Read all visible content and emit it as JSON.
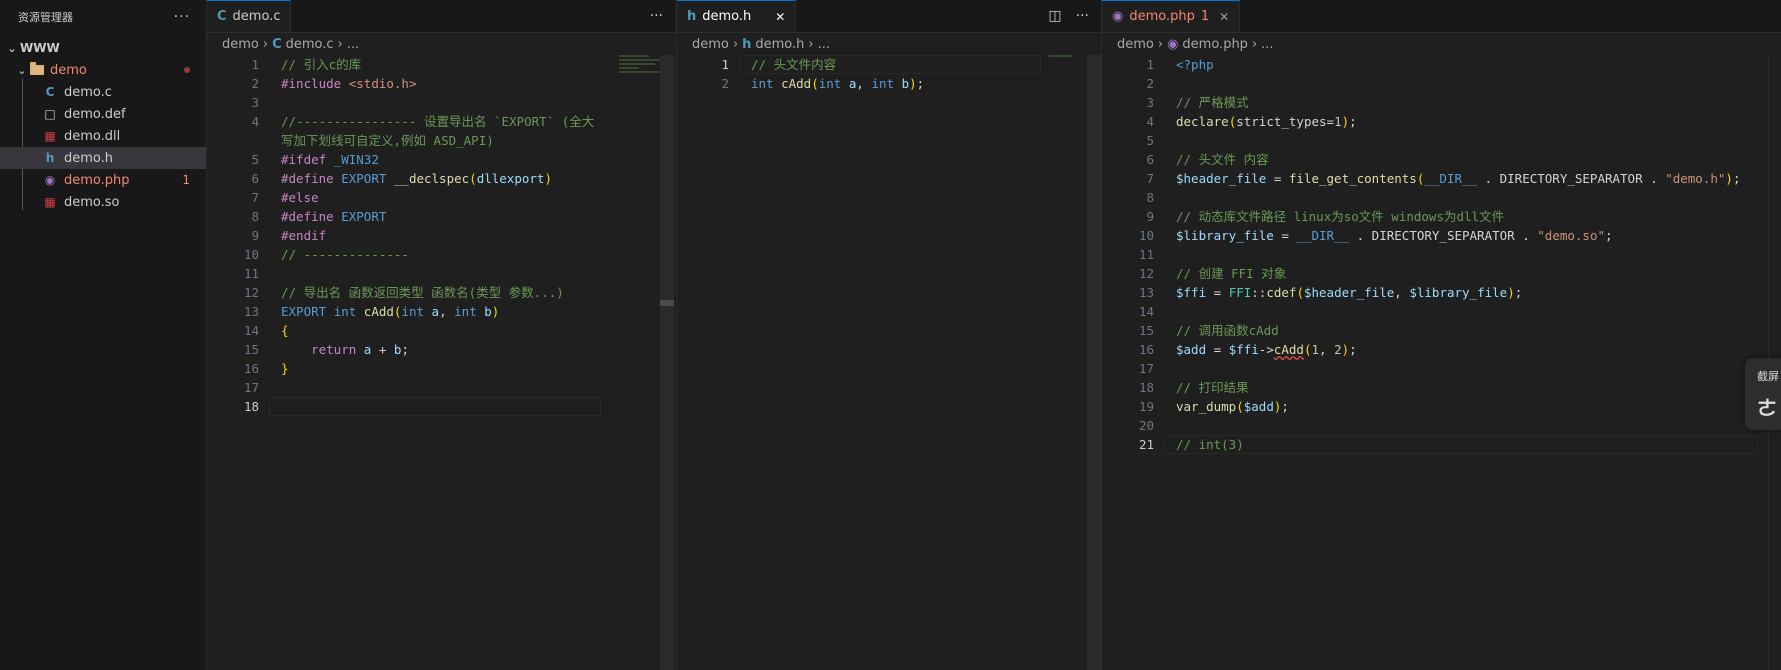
{
  "explorer": {
    "title": "资源管理器",
    "more": "···",
    "root": "WWW",
    "folder": "demo",
    "files": [
      {
        "name": "demo.c",
        "icon": "C",
        "color": "#519aba"
      },
      {
        "name": "demo.def",
        "icon": "□",
        "color": "#cccccc"
      },
      {
        "name": "demo.dll",
        "icon": "▦",
        "color": "#cc3e44"
      },
      {
        "name": "demo.h",
        "icon": "h",
        "color": "#519aba"
      },
      {
        "name": "demo.php",
        "icon": "◉",
        "color": "#a074c4",
        "badge": "1"
      },
      {
        "name": "demo.so",
        "icon": "▦",
        "color": "#cc3e44"
      }
    ]
  },
  "group1": {
    "tab": "demo.c",
    "tab_icon": "C",
    "more": "···",
    "breadcrumb": {
      "folder": "demo",
      "file": "demo.c",
      "rest": "..."
    },
    "current_line": 18,
    "lines": [
      {
        "n": 1,
        "segs": [
          [
            "c-com",
            "// 引入c的库"
          ]
        ]
      },
      {
        "n": 2,
        "segs": [
          [
            "c-pre",
            "#include"
          ],
          [
            "c-plain",
            " "
          ],
          [
            "c-str",
            "<stdio.h>"
          ]
        ]
      },
      {
        "n": 3,
        "segs": []
      },
      {
        "n": 4,
        "segs": [
          [
            "c-com",
            "//---------------- 设置导出名 `EXPORT` (全大"
          ]
        ]
      },
      {
        "n": "",
        "segs": [
          [
            "c-com",
            "写加下划线可自定义,例如 ASD_API)"
          ]
        ]
      },
      {
        "n": 5,
        "segs": [
          [
            "c-pre",
            "#ifdef"
          ],
          [
            "c-plain",
            " "
          ],
          [
            "c-kw",
            "_WIN32"
          ]
        ]
      },
      {
        "n": 6,
        "segs": [
          [
            "c-pre",
            "#define"
          ],
          [
            "c-plain",
            " "
          ],
          [
            "c-macro",
            "EXPORT"
          ],
          [
            "c-plain",
            " "
          ],
          [
            "c-fn",
            "__declspec"
          ],
          [
            "c-br",
            "("
          ],
          [
            "c-var",
            "dllexport"
          ],
          [
            "c-br",
            ")"
          ]
        ]
      },
      {
        "n": 7,
        "segs": [
          [
            "c-pre",
            "#else"
          ]
        ]
      },
      {
        "n": 8,
        "segs": [
          [
            "c-pre",
            "#define"
          ],
          [
            "c-plain",
            " "
          ],
          [
            "c-macro",
            "EXPORT"
          ]
        ]
      },
      {
        "n": 9,
        "segs": [
          [
            "c-pre",
            "#endif"
          ]
        ]
      },
      {
        "n": 10,
        "segs": [
          [
            "c-com",
            "// --------------"
          ]
        ]
      },
      {
        "n": 11,
        "segs": []
      },
      {
        "n": 12,
        "segs": [
          [
            "c-com",
            "// 导出名 函数返回类型 函数名(类型 参数...)"
          ]
        ]
      },
      {
        "n": 13,
        "segs": [
          [
            "c-macro",
            "EXPORT"
          ],
          [
            "c-plain",
            " "
          ],
          [
            "c-kw",
            "int"
          ],
          [
            "c-plain",
            " "
          ],
          [
            "c-fn",
            "cAdd"
          ],
          [
            "c-br",
            "("
          ],
          [
            "c-kw",
            "int"
          ],
          [
            "c-plain",
            " "
          ],
          [
            "c-var",
            "a"
          ],
          [
            "c-plain",
            ", "
          ],
          [
            "c-kw",
            "int"
          ],
          [
            "c-plain",
            " "
          ],
          [
            "c-var",
            "b"
          ],
          [
            "c-br",
            ")"
          ]
        ]
      },
      {
        "n": 14,
        "segs": [
          [
            "c-br",
            "{"
          ]
        ]
      },
      {
        "n": 15,
        "segs": [
          [
            "c-plain",
            "    "
          ],
          [
            "c-pre",
            "return"
          ],
          [
            "c-plain",
            " "
          ],
          [
            "c-var",
            "a"
          ],
          [
            "c-plain",
            " + "
          ],
          [
            "c-var",
            "b"
          ],
          [
            "c-plain",
            ";"
          ]
        ]
      },
      {
        "n": 16,
        "segs": [
          [
            "c-br",
            "}"
          ]
        ]
      },
      {
        "n": 17,
        "segs": []
      },
      {
        "n": 18,
        "segs": []
      }
    ]
  },
  "group2": {
    "tab": "demo.h",
    "tab_icon": "h",
    "close": "✕",
    "more": "···",
    "split": "◫",
    "breadcrumb": {
      "folder": "demo",
      "file": "demo.h",
      "rest": "..."
    },
    "current_line": 1,
    "lines": [
      {
        "n": 1,
        "segs": [
          [
            "c-com",
            "// 头文件内容"
          ]
        ]
      },
      {
        "n": 2,
        "segs": [
          [
            "c-kw",
            "int"
          ],
          [
            "c-plain",
            " "
          ],
          [
            "c-fn",
            "cAdd"
          ],
          [
            "c-br",
            "("
          ],
          [
            "c-kw",
            "int"
          ],
          [
            "c-plain",
            " "
          ],
          [
            "c-var",
            "a"
          ],
          [
            "c-plain",
            ", "
          ],
          [
            "c-kw",
            "int"
          ],
          [
            "c-plain",
            " "
          ],
          [
            "c-var",
            "b"
          ],
          [
            "c-br",
            ")"
          ],
          [
            "c-plain",
            ";"
          ]
        ]
      }
    ]
  },
  "group3": {
    "tab": "demo.php",
    "tab_badge": "1",
    "close": "✕",
    "breadcrumb": {
      "folder": "demo",
      "file": "demo.php",
      "rest": "..."
    },
    "current_line": 21,
    "lines": [
      {
        "n": 1,
        "segs": [
          [
            "c-kw",
            "<?php"
          ]
        ]
      },
      {
        "n": 2,
        "segs": []
      },
      {
        "n": 3,
        "segs": [
          [
            "c-com",
            "// 严格模式"
          ]
        ]
      },
      {
        "n": 4,
        "segs": [
          [
            "c-fn",
            "declare"
          ],
          [
            "c-br",
            "("
          ],
          [
            "c-plain",
            "strict_types="
          ],
          [
            "c-num",
            "1"
          ],
          [
            "c-br",
            ")"
          ],
          [
            "c-plain",
            ";"
          ]
        ]
      },
      {
        "n": 5,
        "segs": []
      },
      {
        "n": 6,
        "segs": [
          [
            "c-com",
            "// 头文件 内容"
          ]
        ]
      },
      {
        "n": 7,
        "segs": [
          [
            "c-var",
            "$header_file"
          ],
          [
            "c-plain",
            " = "
          ],
          [
            "c-fn",
            "file_get_contents"
          ],
          [
            "c-br",
            "("
          ],
          [
            "c-kw",
            "__DIR__"
          ],
          [
            "c-plain",
            " . DIRECTORY_SEPARATOR . "
          ],
          [
            "c-str",
            "\"demo.h\""
          ],
          [
            "c-br",
            ")"
          ],
          [
            "c-plain",
            ";"
          ]
        ]
      },
      {
        "n": 8,
        "segs": []
      },
      {
        "n": 9,
        "segs": [
          [
            "c-com",
            "// 动态库文件路径 linux为so文件 windows为dll文件"
          ]
        ]
      },
      {
        "n": 10,
        "segs": [
          [
            "c-var",
            "$library_file"
          ],
          [
            "c-plain",
            " = "
          ],
          [
            "c-kw",
            "__DIR__"
          ],
          [
            "c-plain",
            " . DIRECTORY_SEPARATOR . "
          ],
          [
            "c-str",
            "\"demo.so\""
          ],
          [
            "c-plain",
            ";"
          ]
        ]
      },
      {
        "n": 11,
        "segs": []
      },
      {
        "n": 12,
        "segs": [
          [
            "c-com",
            "// 创建 FFI 对象"
          ]
        ]
      },
      {
        "n": 13,
        "segs": [
          [
            "c-var",
            "$ffi"
          ],
          [
            "c-plain",
            " = "
          ],
          [
            "c-cls",
            "FFI"
          ],
          [
            "c-plain",
            "::"
          ],
          [
            "c-fn",
            "cdef"
          ],
          [
            "c-br",
            "("
          ],
          [
            "c-var",
            "$header_file"
          ],
          [
            "c-plain",
            ", "
          ],
          [
            "c-var",
            "$library_file"
          ],
          [
            "c-br",
            ")"
          ],
          [
            "c-plain",
            ";"
          ]
        ]
      },
      {
        "n": 14,
        "segs": []
      },
      {
        "n": 15,
        "segs": [
          [
            "c-com",
            "// 调用函数cAdd"
          ]
        ]
      },
      {
        "n": 16,
        "segs": [
          [
            "c-var",
            "$add"
          ],
          [
            "c-plain",
            " = "
          ],
          [
            "c-var",
            "$ffi"
          ],
          [
            "c-plain",
            "->"
          ],
          [
            "c-fn squiggle",
            "cAdd"
          ],
          [
            "c-br",
            "("
          ],
          [
            "c-num",
            "1"
          ],
          [
            "c-plain",
            ", "
          ],
          [
            "c-num",
            "2"
          ],
          [
            "c-br",
            ")"
          ],
          [
            "c-plain",
            ";"
          ]
        ]
      },
      {
        "n": 17,
        "segs": []
      },
      {
        "n": 18,
        "segs": [
          [
            "c-com",
            "// 打印结果"
          ]
        ]
      },
      {
        "n": 19,
        "segs": [
          [
            "c-fn",
            "var_dump"
          ],
          [
            "c-br",
            "("
          ],
          [
            "c-var",
            "$add"
          ],
          [
            "c-br",
            ")"
          ],
          [
            "c-plain",
            ";"
          ]
        ]
      },
      {
        "n": 20,
        "segs": []
      },
      {
        "n": 21,
        "segs": [
          [
            "c-com",
            "// int(3)"
          ]
        ]
      }
    ]
  },
  "toast": {
    "text": "截屏",
    "glyph": "ㄜ"
  }
}
